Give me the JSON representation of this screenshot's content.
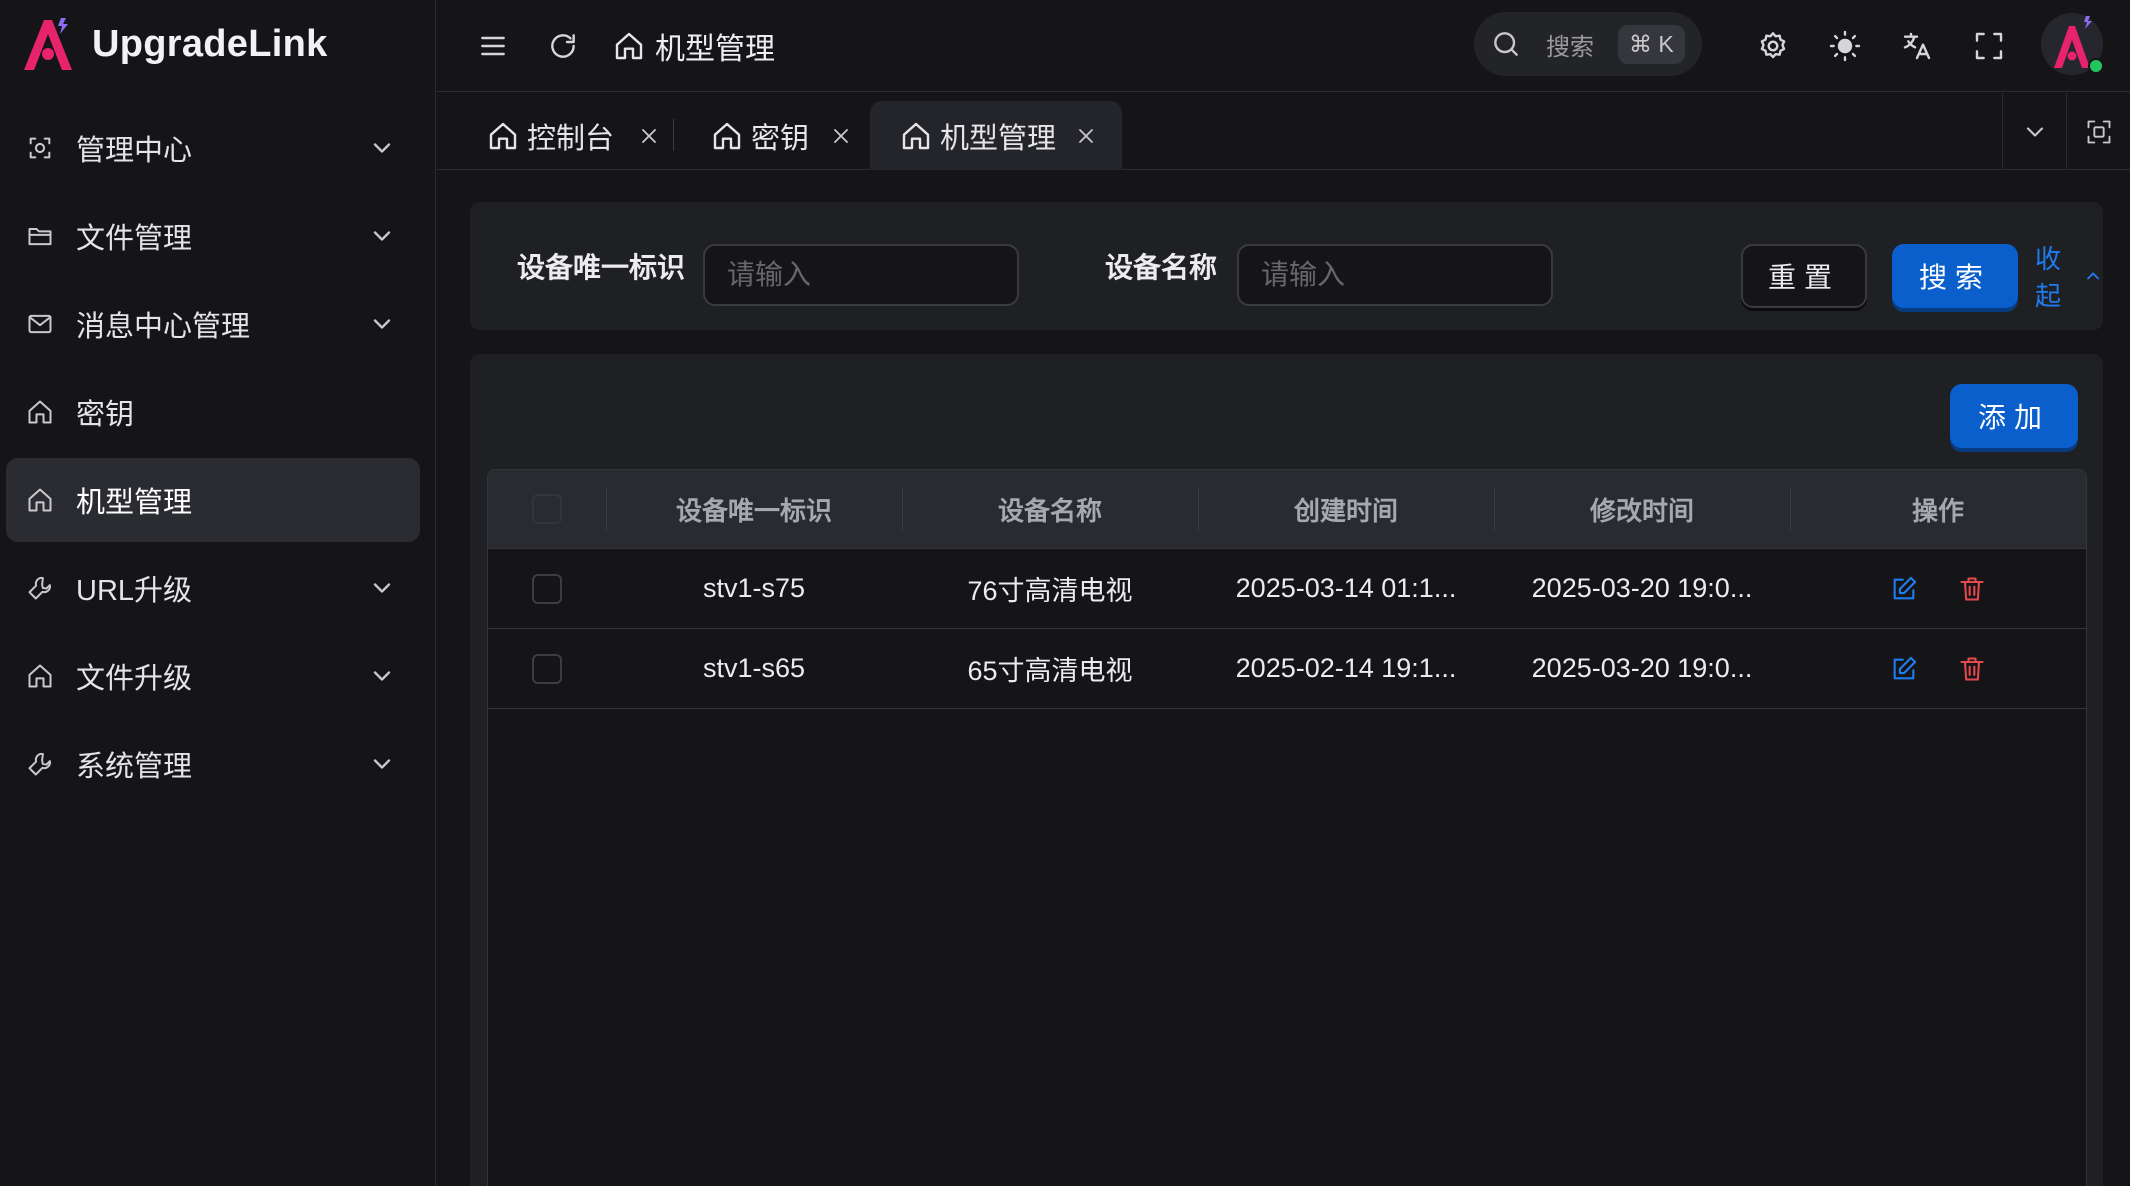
{
  "app": {
    "logo_text": "UpgradeLink"
  },
  "colors": {
    "accent": "#0a5fcc",
    "link": "#1f7cf0",
    "logo_pink": "#e6236b",
    "delete": "#e5484d",
    "online": "#22c55e"
  },
  "sidebar": {
    "items": [
      {
        "label": "管理中心",
        "icon": "scan-icon",
        "expandable": true,
        "active": false
      },
      {
        "label": "文件管理",
        "icon": "folder-icon",
        "expandable": true,
        "active": false
      },
      {
        "label": "消息中心管理",
        "icon": "mail-icon",
        "expandable": true,
        "active": false
      },
      {
        "label": "密钥",
        "icon": "home-icon",
        "expandable": false,
        "active": false
      },
      {
        "label": "机型管理",
        "icon": "home-icon",
        "expandable": false,
        "active": true
      },
      {
        "label": "URL升级",
        "icon": "wrench-icon",
        "expandable": true,
        "active": false
      },
      {
        "label": "文件升级",
        "icon": "home-icon",
        "expandable": true,
        "active": false
      },
      {
        "label": "系统管理",
        "icon": "wrench-icon",
        "expandable": true,
        "active": false
      }
    ]
  },
  "header": {
    "breadcrumb": "机型管理",
    "search_label": "搜索",
    "search_shortcut": "⌘ K"
  },
  "tabs": [
    {
      "label": "控制台",
      "active": false
    },
    {
      "label": "密钥",
      "active": false
    },
    {
      "label": "机型管理",
      "active": true
    }
  ],
  "filter": {
    "device_id_label": "设备唯一标识",
    "device_id_placeholder": "请输入",
    "device_name_label": "设备名称",
    "device_name_placeholder": "请输入",
    "reset_label": "重置",
    "search_label": "搜索",
    "collapse_label": "收起"
  },
  "table": {
    "add_label": "添加",
    "columns": [
      "设备唯一标识",
      "设备名称",
      "创建时间",
      "修改时间",
      "操作"
    ],
    "rows": [
      {
        "device_id": "stv1-s75",
        "device_name": "76寸高清电视",
        "created": "2025-03-14 01:1...",
        "modified": "2025-03-20 19:0..."
      },
      {
        "device_id": "stv1-s65",
        "device_name": "65寸高清电视",
        "created": "2025-02-14 19:1...",
        "modified": "2025-03-20 19:0..."
      }
    ]
  }
}
